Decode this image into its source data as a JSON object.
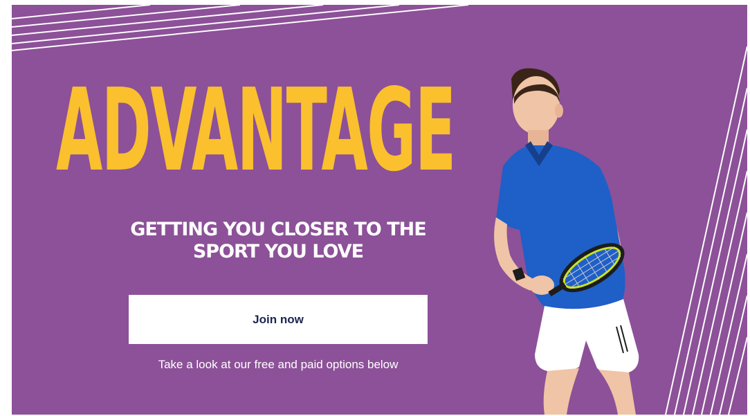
{
  "banner": {
    "headline": "ADVANTAGE",
    "tagline_line1": "GETTING YOU CLOSER TO THE",
    "tagline_line2": "SPORT YOU LOVE",
    "join_label": "Join now",
    "options_text": "Take a look at our free and paid options below"
  },
  "colors": {
    "background": "#8c5198",
    "headline": "#fbc02d",
    "button_bg": "#ffffff",
    "button_text": "#1b2550",
    "shirt": "#1f5fc8",
    "shorts": "#ffffff"
  },
  "images": {
    "player": "tennis-player-image"
  }
}
